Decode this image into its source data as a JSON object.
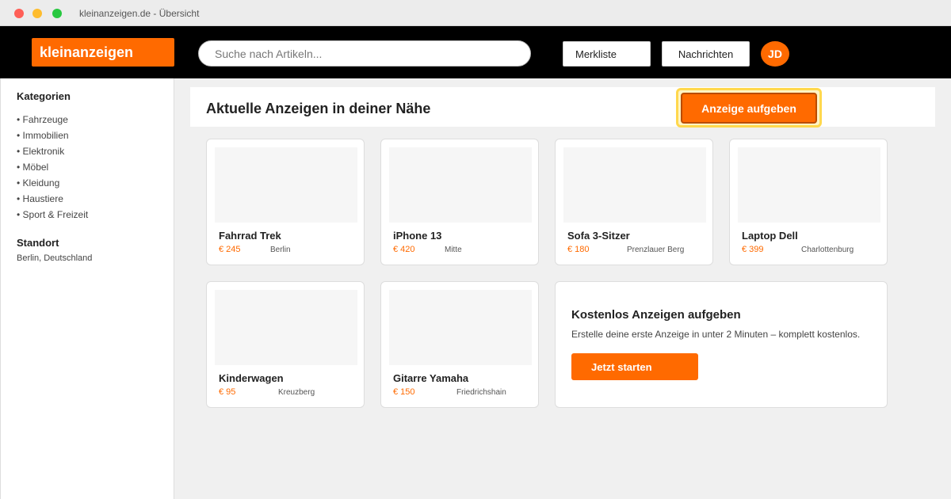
{
  "window": {
    "title": "kleinanzeigen.de - Übersicht"
  },
  "header": {
    "logo": "kleinanzeigen",
    "search_placeholder": "Suche nach Artikeln...",
    "watchlist_label": "Merkliste",
    "messages_label": "Nachrichten",
    "avatar_initials": "JD"
  },
  "sidebar": {
    "categories_heading": "Kategorien",
    "categories": [
      "• Fahrzeuge",
      "• Immobilien",
      "• Elektronik",
      "• Möbel",
      "• Kleidung",
      "• Haustiere",
      "• Sport & Freizeit"
    ],
    "location_heading": "Standort",
    "location_value": "Berlin, Deutschland"
  },
  "main": {
    "title": "Aktuelle Anzeigen in deiner Nähe",
    "cta_label": "Anzeige aufgeben",
    "listings": [
      {
        "title": "Fahrrad Trek",
        "price": "€ 245",
        "location": "Berlin"
      },
      {
        "title": "iPhone 13",
        "price": "€ 420",
        "location": "Mitte"
      },
      {
        "title": "Sofa 3-Sitzer",
        "price": "€ 180",
        "location": "Prenzlauer Berg"
      },
      {
        "title": "Laptop Dell",
        "price": "€ 399",
        "location": "Charlottenburg"
      },
      {
        "title": "Kinderwagen",
        "price": "€ 95",
        "location": "Kreuzberg"
      },
      {
        "title": "Gitarre Yamaha",
        "price": "€ 150",
        "location": "Friedrichshain"
      }
    ],
    "promo": {
      "title": "Kostenlos Anzeigen aufgeben",
      "text": "Erstelle deine erste Anzeige in unter 2 Minuten – komplett kostenlos.",
      "button_label": "Jetzt starten"
    }
  },
  "colors": {
    "brand": "#ff6a00",
    "header_bg": "#000000",
    "highlight": "#ffd84d"
  }
}
